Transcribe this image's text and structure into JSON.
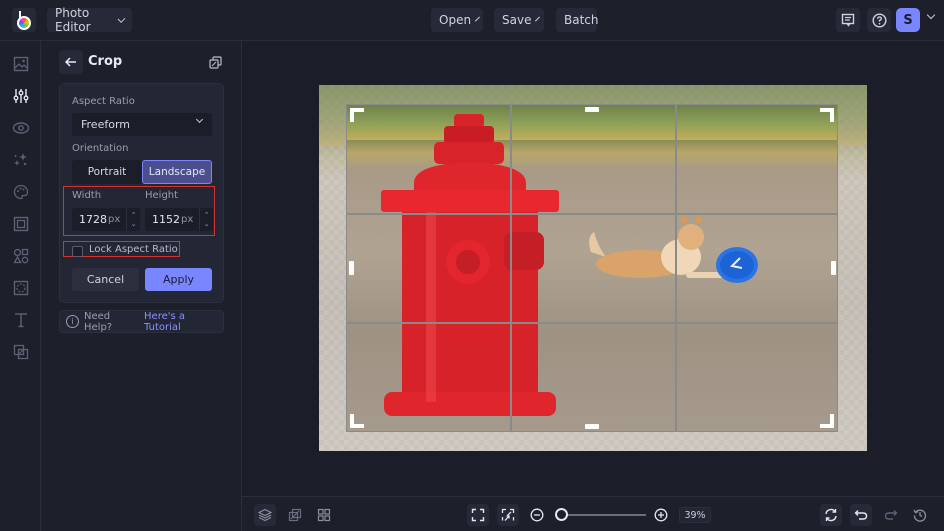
{
  "topbar": {
    "app_menu_label": "Photo Editor",
    "open_label": "Open",
    "save_label": "Save",
    "batch_label": "Batch",
    "avatar_initial": "S"
  },
  "rail": {
    "items": [
      {
        "icon": "image-icon",
        "active": false
      },
      {
        "icon": "adjustments-icon",
        "active": true
      },
      {
        "icon": "eye-icon",
        "active": false
      },
      {
        "icon": "sparkles-icon",
        "active": false
      },
      {
        "icon": "palette-icon",
        "active": false
      },
      {
        "icon": "frame-icon",
        "active": false
      },
      {
        "icon": "shapes-icon",
        "active": false
      },
      {
        "icon": "texture-icon",
        "active": false
      },
      {
        "icon": "text-icon",
        "active": false
      },
      {
        "icon": "overlay-icon",
        "active": false
      }
    ]
  },
  "panel": {
    "title": "Crop",
    "aspect_ratio_label": "Aspect Ratio",
    "aspect_ratio_value": "Freeform",
    "orientation_label": "Orientation",
    "orientation_options": [
      "Portrait",
      "Landscape"
    ],
    "orientation_selected": "Landscape",
    "width_label": "Width",
    "height_label": "Height",
    "width_value": "1728",
    "height_value": "1152",
    "unit": "px",
    "lock_label": "Lock Aspect Ratio",
    "lock_checked": false,
    "cancel_label": "Cancel",
    "apply_label": "Apply",
    "help_text": "Need Help?",
    "help_link": "Here's a Tutorial"
  },
  "bottombar": {
    "zoom_percent": "39%"
  },
  "colors": {
    "accent": "#7a86ff",
    "highlight_border": "#d6322f",
    "background": "#1b1d28",
    "panel": "#1d1f2b"
  }
}
